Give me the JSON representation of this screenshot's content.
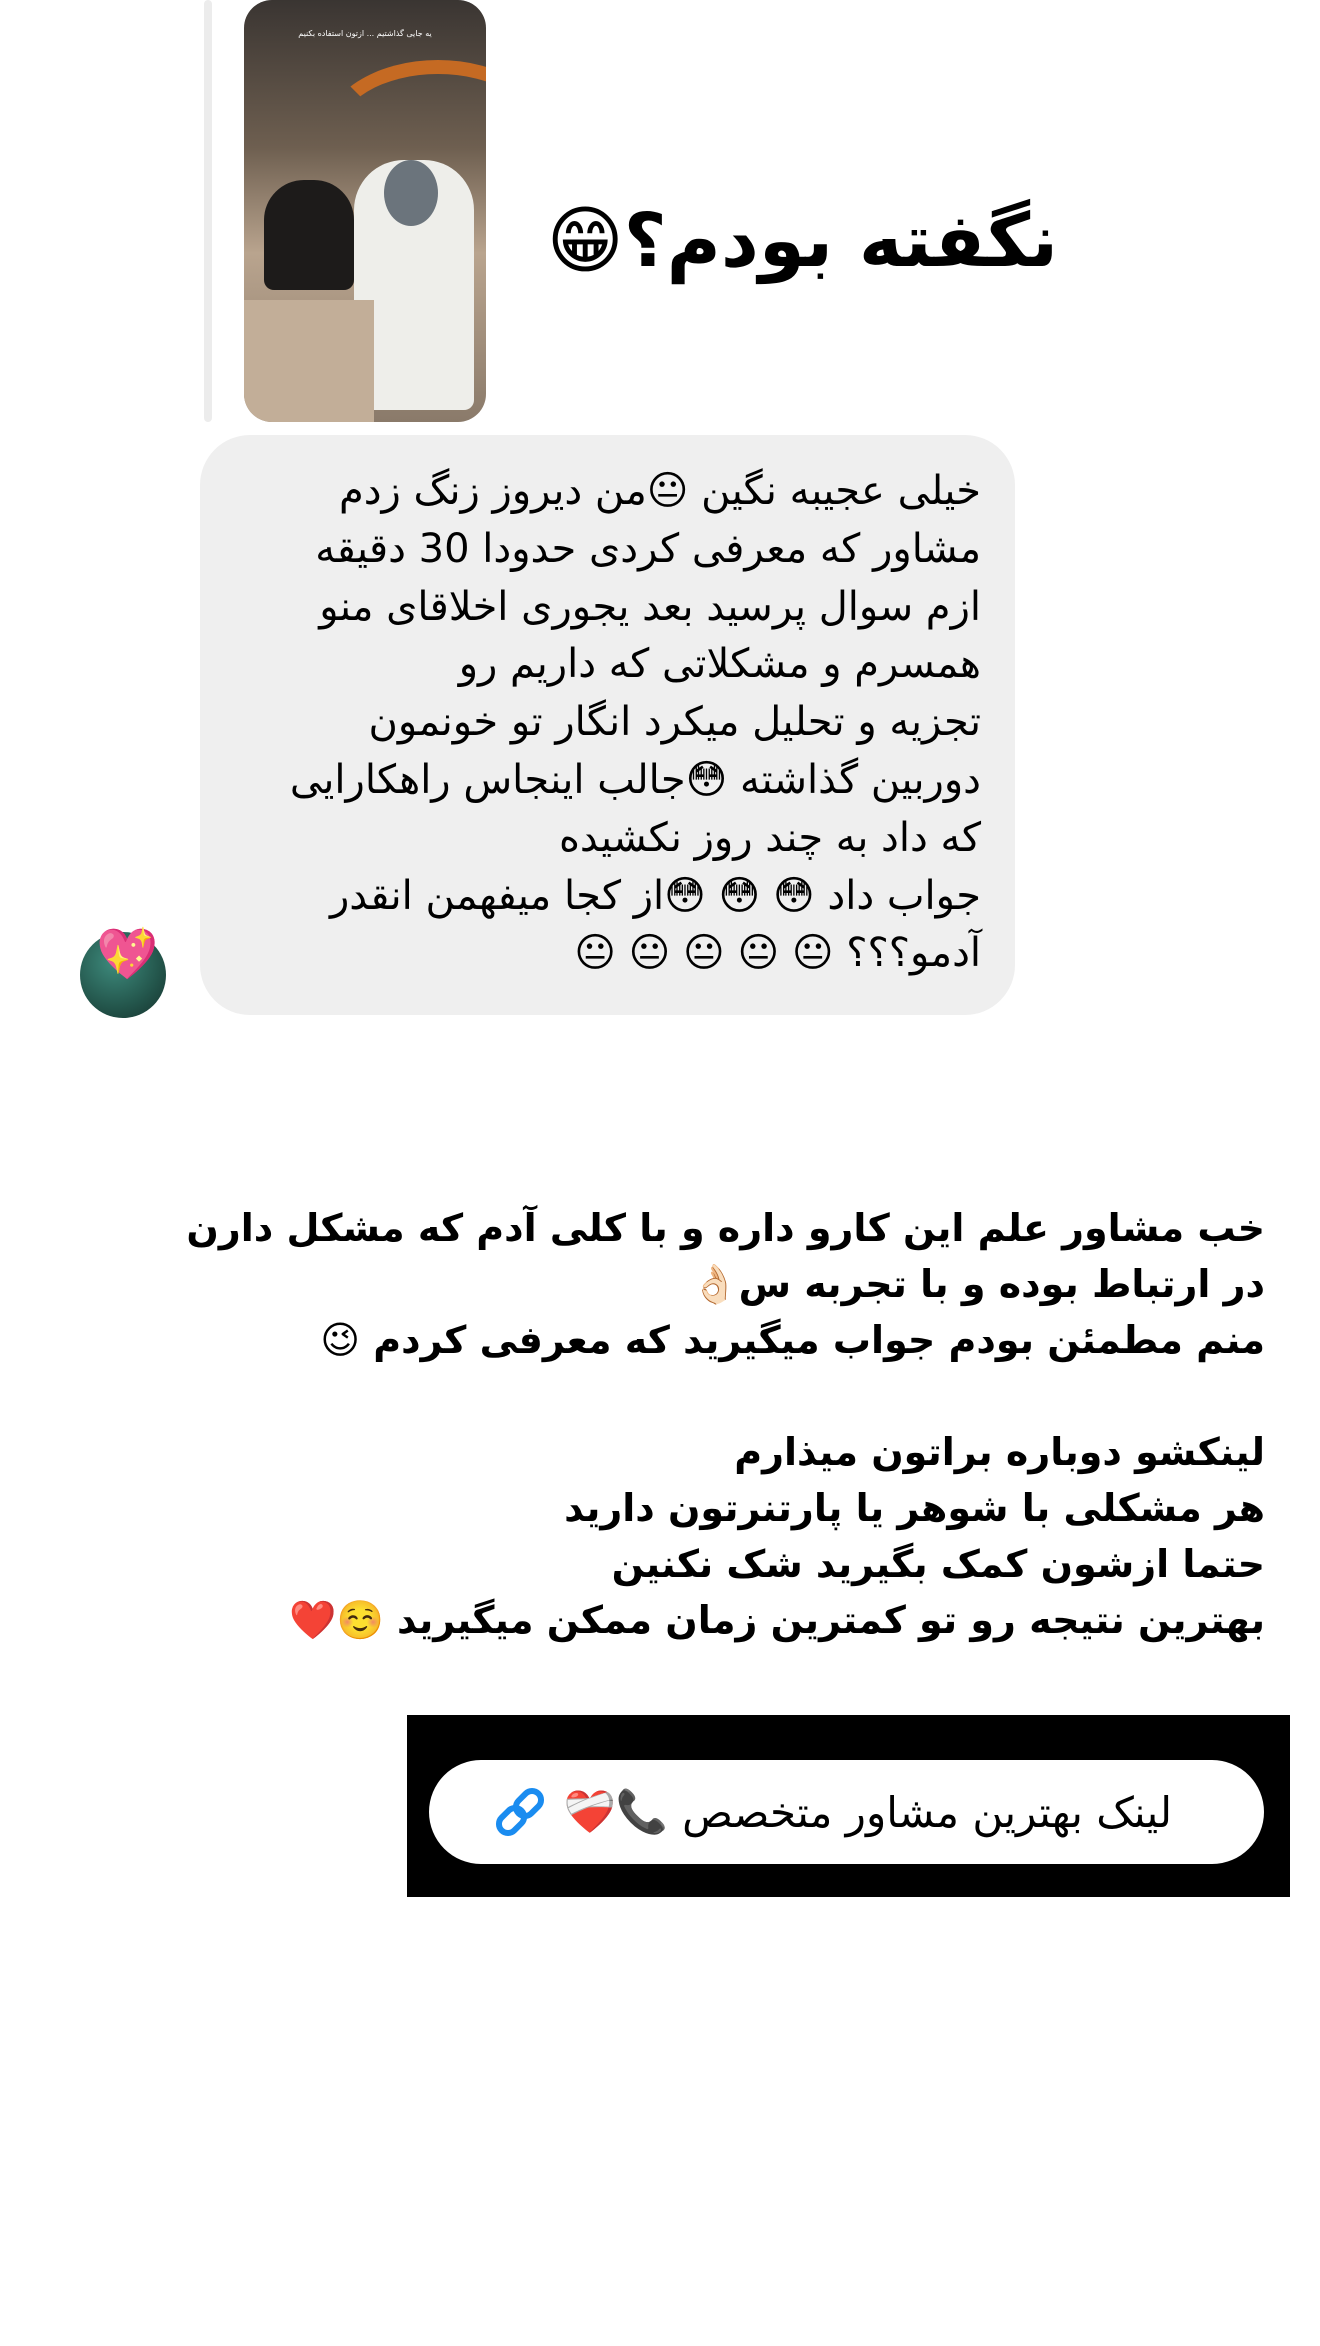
{
  "story_reply": {
    "thumbnail_caption": "یه جایی گذاشتیم ... ازتون استفاده بکنیم",
    "title": "نگفته بودم؟😁"
  },
  "message_bubble": {
    "lines": [
      "خیلی عجیبه نگین 😐من دیروز زنگ زدم",
      "مشاور که معرفی کردی حدودا 30 دقیقه",
      "ازم سوال پرسید بعد یجوری اخلاقای منو",
      "همسرم و مشکلاتی که داریم رو",
      "تجزیه و تحلیل میکرد انگار تو خونمون",
      "دوربین گذاشته 😳جالب اینجاس راهکارایی",
      "که داد به چند روز نکشیده",
      "جواب داد 😳 😳 😳از کجا میفهمن انقدر",
      "آدمو؟؟؟ 😐 😐 😐 😐 😐"
    ]
  },
  "sender_avatar": {
    "sticker": "💖"
  },
  "post_text": {
    "lines": [
      "خب مشاور علم این کارو داره و با کلی آدم که مشکل دارن",
      "در ارتباط بوده و با تجربه س👌🏻",
      "منم مطمئن بودم جواب میگیرید که معرفی کردم 😉",
      "",
      "لینکشو دوباره براتون میذارم",
      "هر مشکلی با شوهر یا پارتنرتون دارید",
      "حتما ازشون کمک بگیرید شک نکنین",
      "بهترین نتیجه رو تو کمترین زمان ممکن میگیرید ☺️❤️"
    ]
  },
  "link_sticker": {
    "label": "لینک بهترین مشاور متخصص",
    "emojis": "❤️‍🩹📞",
    "icon": "link-icon",
    "icon_color": "#1a8cf0"
  }
}
